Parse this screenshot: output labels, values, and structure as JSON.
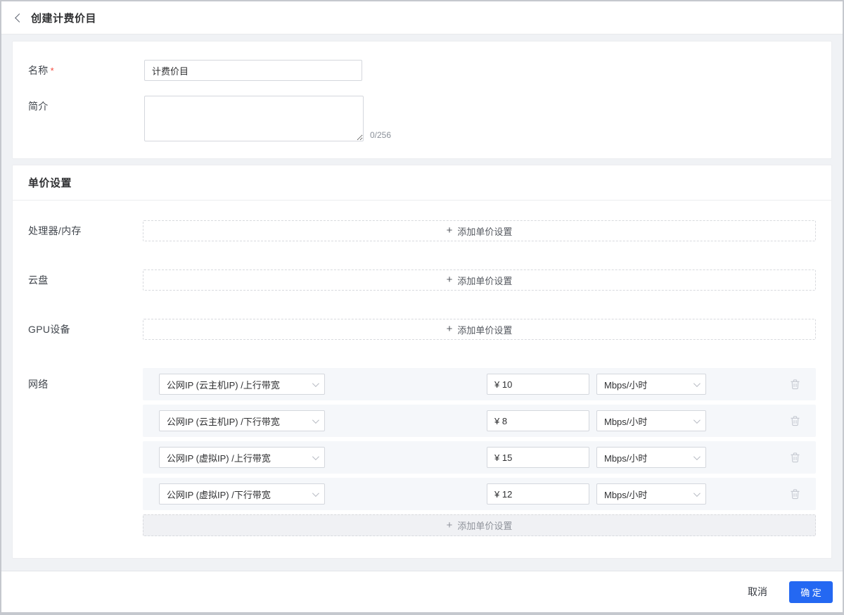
{
  "header": {
    "title": "创建计费价目"
  },
  "basic": {
    "name_label": "名称",
    "required_mark": "*",
    "name_value": "计费价目",
    "desc_label": "简介",
    "desc_value": "",
    "desc_counter": "0/256"
  },
  "pricing": {
    "title": "单价设置",
    "plus": "+",
    "add_label": "添加单价设置",
    "rows": [
      {
        "label": "处理器/内存"
      },
      {
        "label": "云盘"
      },
      {
        "label": "GPU设备"
      },
      {
        "label": "网络"
      }
    ],
    "network_rows": [
      {
        "option": "公网IP (云主机IP) /上行带宽",
        "price": "¥ 10",
        "unit": "Mbps/小时"
      },
      {
        "option": "公网IP (云主机IP) /下行带宽",
        "price": "¥ 8",
        "unit": "Mbps/小时"
      },
      {
        "option": "公网IP (虚拟IP) /上行带宽",
        "price": "¥ 15",
        "unit": "Mbps/小时"
      },
      {
        "option": "公网IP (虚拟IP) /下行带宽",
        "price": "¥ 12",
        "unit": "Mbps/小时"
      }
    ]
  },
  "footer": {
    "cancel_label": "取消",
    "confirm_label": "确 定"
  },
  "colors": {
    "primary": "#2468f2",
    "required_mark": "#f5483b",
    "network_row_bg": "#f5f7fa",
    "page_bg": "#f0f2f5"
  }
}
